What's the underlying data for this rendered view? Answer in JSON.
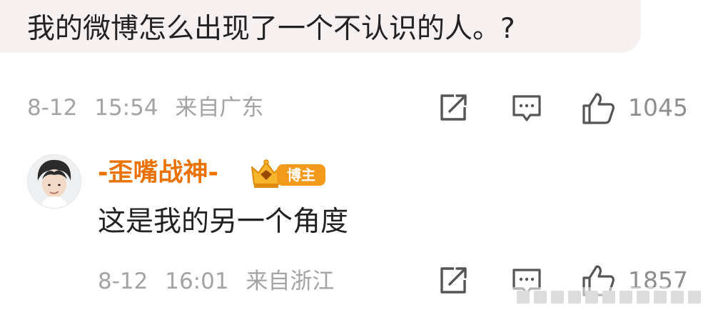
{
  "post": {
    "text": "我的微博怎么出现了一个不认识的人。?",
    "date": "8-12",
    "time": "15:54",
    "location": "来自广东",
    "like_count": "1045"
  },
  "reply": {
    "username": "-歪嘴战神-",
    "badge_label": "博主",
    "text": "这是我的另一个角度",
    "date": "8-12",
    "time": "16:01",
    "location": "来自浙江",
    "like_count": "1857"
  },
  "colors": {
    "bubble_bg": "#f6f0f1",
    "username": "#eb7100",
    "meta_text": "#a3a3a3",
    "badge": "#f39a1d"
  },
  "icons": {
    "repost": "share-square-icon",
    "comment": "comment-bubble-icon",
    "like": "thumbs-up-icon",
    "badge": "crown-badge-icon"
  }
}
